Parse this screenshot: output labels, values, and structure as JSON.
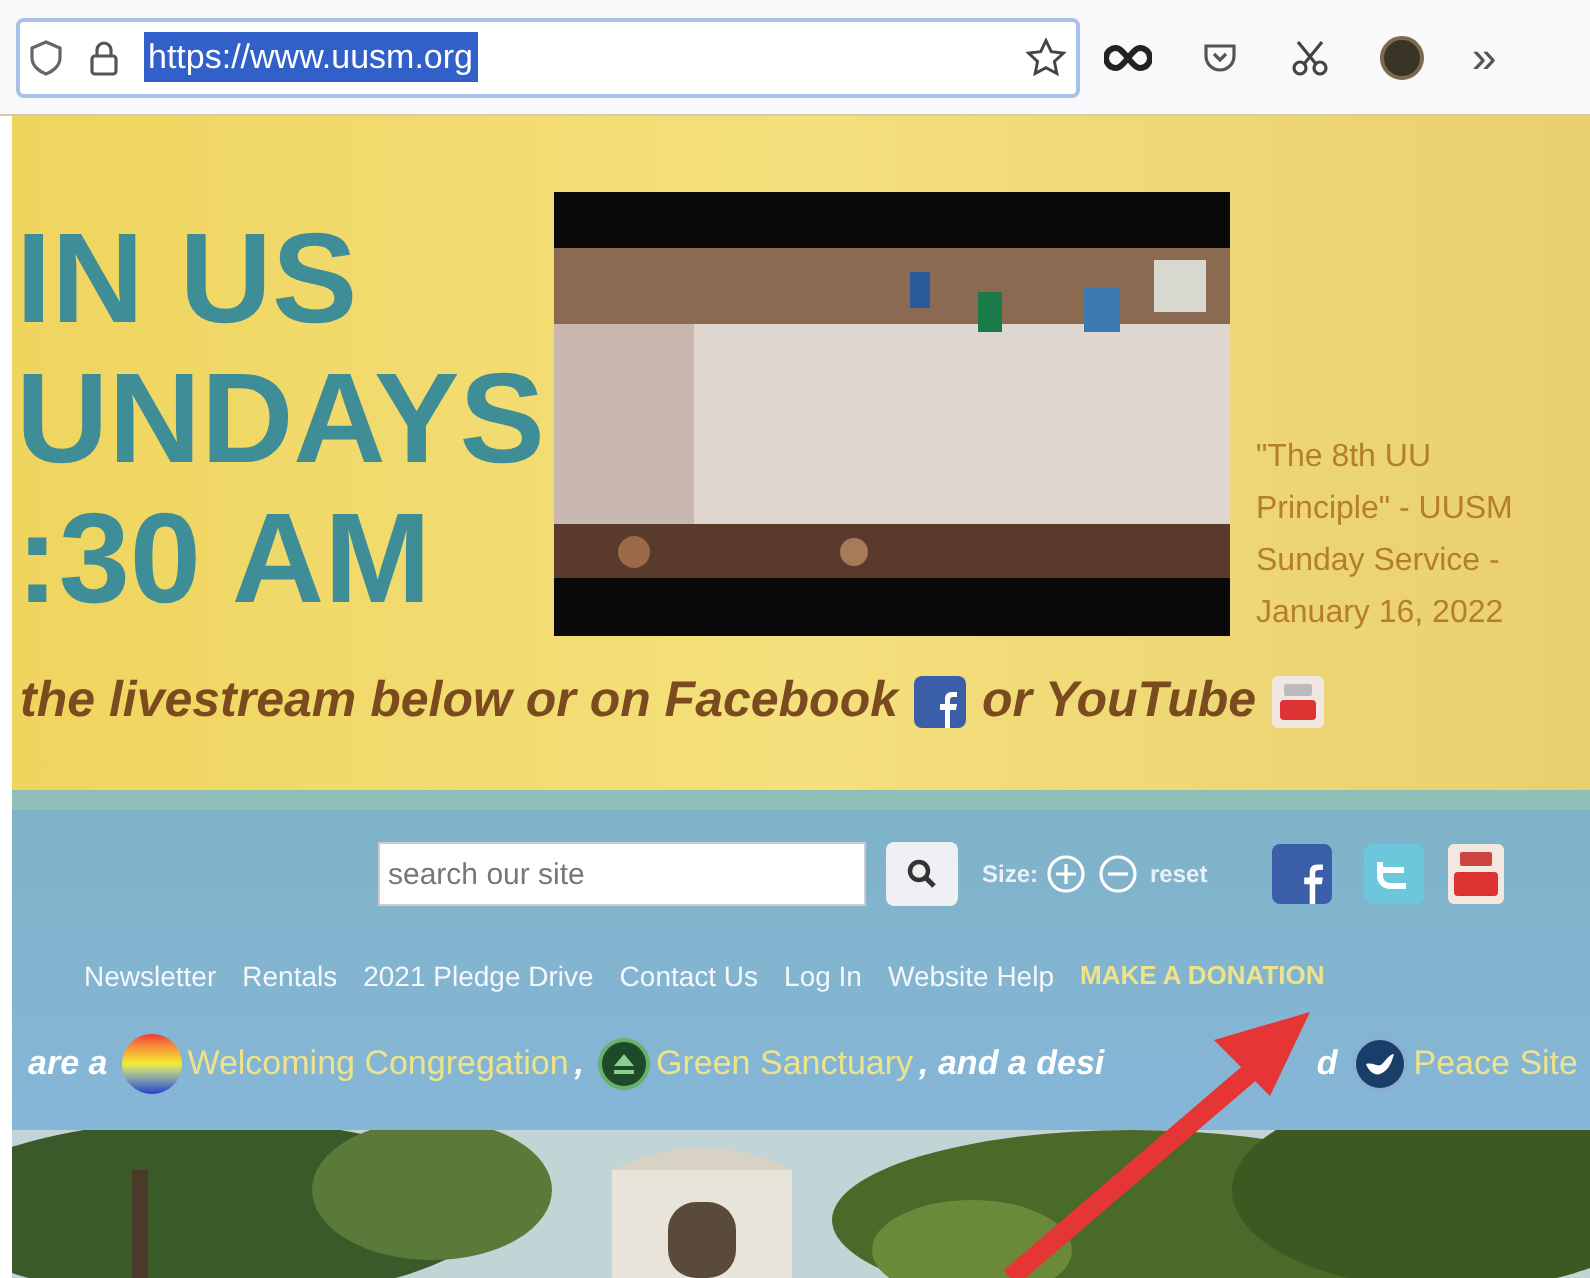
{
  "browser": {
    "url": "https://www.uusm.org",
    "url_selected": true,
    "overflow": "»"
  },
  "banner": {
    "headline": [
      "IN US",
      "UNDAYS",
      ":30 AM"
    ],
    "video_caption": "\"The 8th UU Principle\" - UUSM Sunday Service - January 16, 2022",
    "livestream": "the livestream below or on Facebook",
    "livestream_or": "or YouTube"
  },
  "header": {
    "search": {
      "placeholder": "search our site"
    },
    "size_label": "Size:",
    "reset": "reset",
    "nav": [
      {
        "label": "Newsletter",
        "kind": "link"
      },
      {
        "label": "Rentals",
        "kind": "link"
      },
      {
        "label": "2021 Pledge Drive",
        "kind": "link"
      },
      {
        "label": "Contact Us",
        "kind": "link"
      },
      {
        "label": "Log In",
        "kind": "link"
      },
      {
        "label": "Website Help",
        "kind": "link"
      },
      {
        "label": "MAKE A DONATION",
        "kind": "donate"
      }
    ],
    "welcome": {
      "lead": "are a",
      "welcoming": "Welcoming Congregation",
      "comma": ",",
      "green": "Green Sanctuary",
      "middle": ", and a desi",
      "middle_end": "d",
      "peace": "Peace Site"
    }
  }
}
